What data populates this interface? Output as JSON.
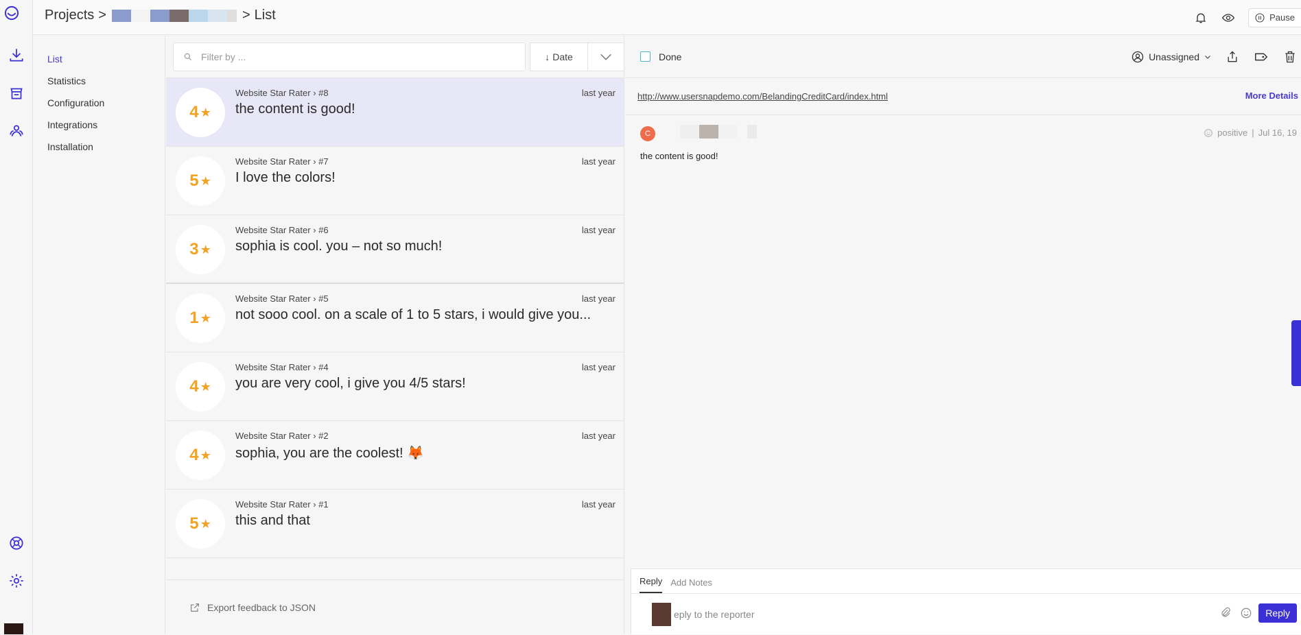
{
  "breadcrumb": {
    "root": "Projects",
    "current": "List",
    "sep": ">"
  },
  "topbar": {
    "pause_label": "Pause"
  },
  "subnav": {
    "items": [
      {
        "label": "List",
        "active": true
      },
      {
        "label": "Statistics"
      },
      {
        "label": "Configuration"
      },
      {
        "label": "Integrations"
      },
      {
        "label": "Installation"
      }
    ]
  },
  "filter": {
    "placeholder": "Filter by ...",
    "sort_label": "Date"
  },
  "feedback_list": [
    {
      "rating": "4",
      "source": "Website Star Rater › #8",
      "time": "last year",
      "text": "the content is good!"
    },
    {
      "rating": "5",
      "source": "Website Star Rater › #7",
      "time": "last year",
      "text": "I love the colors!"
    },
    {
      "rating": "3",
      "source": "Website Star Rater › #6",
      "time": "last year",
      "text": "sophia is cool. you – not so much!"
    },
    {
      "rating": "1",
      "source": "Website Star Rater › #5",
      "time": "last year",
      "text": "not sooo cool. on a scale of 1 to 5 stars, i would give you..."
    },
    {
      "rating": "4",
      "source": "Website Star Rater › #4",
      "time": "last year",
      "text": "you are very cool, i give you 4/5 stars!"
    },
    {
      "rating": "4",
      "source": "Website Star Rater › #2",
      "time": "last year",
      "text": "sophia, you are the coolest! 🦊"
    },
    {
      "rating": "5",
      "source": "Website Star Rater › #1",
      "time": "last year",
      "text": "this and that"
    }
  ],
  "export_label": "Export feedback to JSON",
  "detail": {
    "done_label": "Done",
    "assignee": "Unassigned",
    "url": "http://www.usersnapdemo.com/BelandingCreditCard/index.html",
    "more_details": "More Details",
    "comment": {
      "avatar_letter": "C",
      "sentiment": "positive",
      "date": "Jul 16, 19",
      "text": "the content is good!"
    }
  },
  "reply": {
    "tab_reply": "Reply",
    "tab_notes": "Add Notes",
    "placeholder": "eply to the reporter",
    "button": "Reply"
  },
  "colors": {
    "accent": "#3b2fd6",
    "star": "#f3a323",
    "selected_row": "#e8e7f7"
  }
}
